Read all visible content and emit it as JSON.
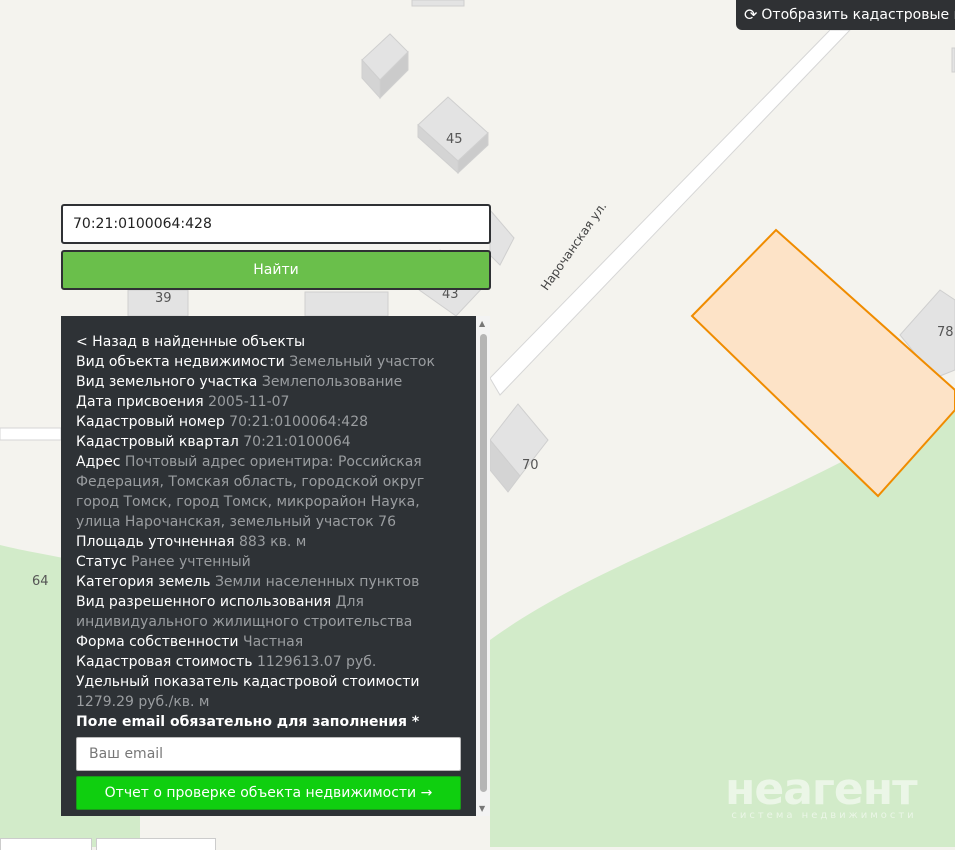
{
  "cadastral_toggle": {
    "label": "Отобразить кадастровые гран",
    "icon": "refresh-icon"
  },
  "search": {
    "value": "70:21:0100064:428",
    "button_label": "Найти"
  },
  "map": {
    "building_numbers": [
      "45",
      "39",
      "43",
      "70",
      "78",
      "64"
    ],
    "street_name": "Нарочанская ул."
  },
  "panel": {
    "back_label": "< Назад в найденные объекты",
    "rows": [
      {
        "key": "Вид объекта недвижимости",
        "value": "Земельный участок"
      },
      {
        "key": "Вид земельного участка",
        "value": "Землепользование"
      },
      {
        "key": "Дата присвоения",
        "value": "2005-11-07"
      },
      {
        "key": "Кадастровый номер",
        "value": "70:21:0100064:428"
      },
      {
        "key": "Кадастровый квартал",
        "value": "70:21:0100064"
      },
      {
        "key": "Адрес",
        "value": "Почтовый адрес ориентира: Российская Федерация, Томская область, городской округ город Томск, город Томск, микрорайон Наука, улица Нарочанская, земельный участок 76"
      },
      {
        "key": "Площадь уточненная",
        "value": "883 кв. м"
      },
      {
        "key": "Статус",
        "value": "Ранее учтенный"
      },
      {
        "key": "Категория земель",
        "value": "Земли населенных пунктов"
      },
      {
        "key": "Вид разрешенного использования",
        "value": "Для индивидуального жилищного строительства"
      },
      {
        "key": "Форма собственности",
        "value": "Частная"
      },
      {
        "key": "Кадастровая стоимость",
        "value": "1129613.07 руб."
      },
      {
        "key": "Удельный показатель кадастровой стоимости",
        "value": "1279.29 руб./кв. м"
      }
    ],
    "email_label": "Поле email обязательно для заполнения *",
    "email_placeholder": "Ваш email",
    "report_button": "Отчет о проверке объекта недвижимости →"
  },
  "watermark": {
    "brand": "неагент",
    "subtitle": "система недвижимости"
  },
  "colors": {
    "parcel_fill": "#fde3c7",
    "parcel_stroke": "#f08c00",
    "panel_bg": "#2e3236",
    "search_button": "#6abf4b",
    "report_button": "#0fcf0f",
    "green_area": "#d2ebc9"
  }
}
